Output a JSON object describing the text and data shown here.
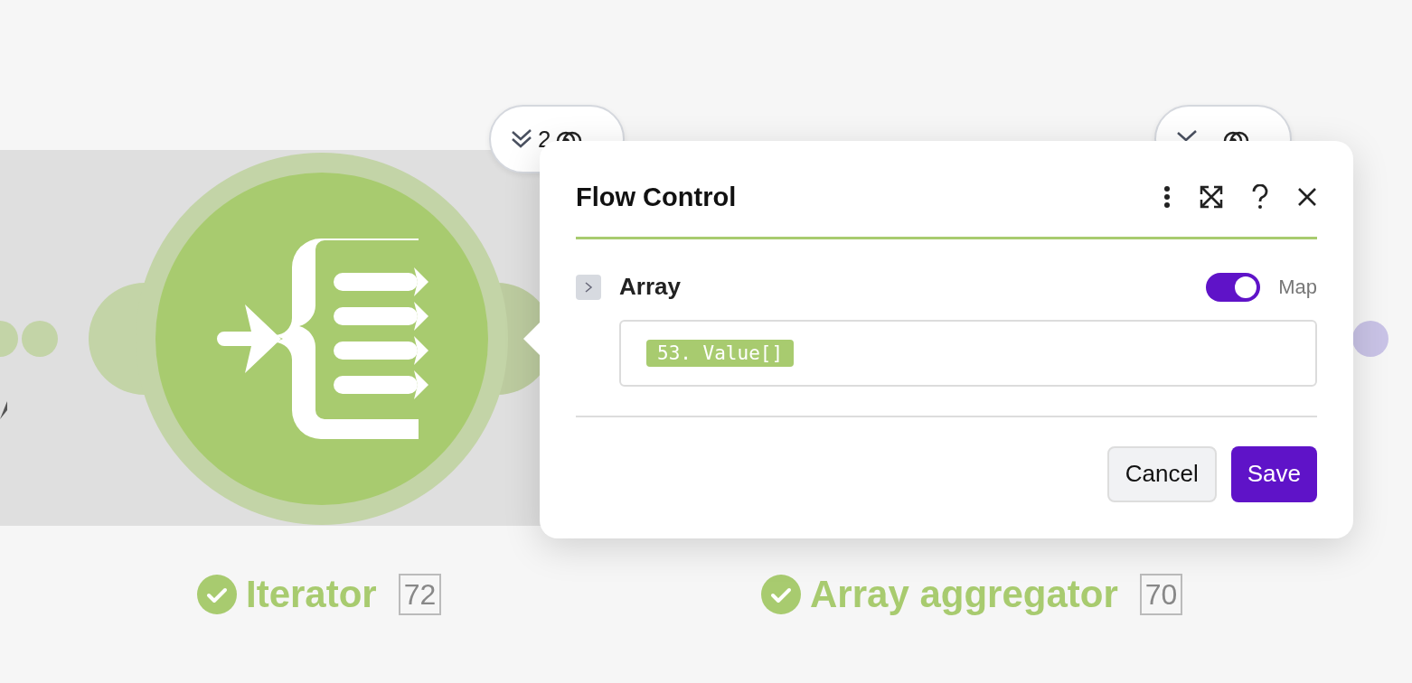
{
  "modules": [
    {
      "name": "Iterator",
      "number": "72",
      "selected": true,
      "badge": {
        "operations": "2"
      }
    },
    {
      "name": "Array aggregator",
      "number": "70",
      "selected": false
    }
  ],
  "dialog": {
    "title": "Flow Control",
    "field": {
      "label": "Array",
      "expanded": false,
      "map": {
        "label": "Map",
        "on": true
      },
      "value": "53. Value[]"
    },
    "buttons": [
      {
        "label": "Cancel",
        "kind": "secondary"
      },
      {
        "label": "Save",
        "kind": "primary"
      }
    ]
  }
}
